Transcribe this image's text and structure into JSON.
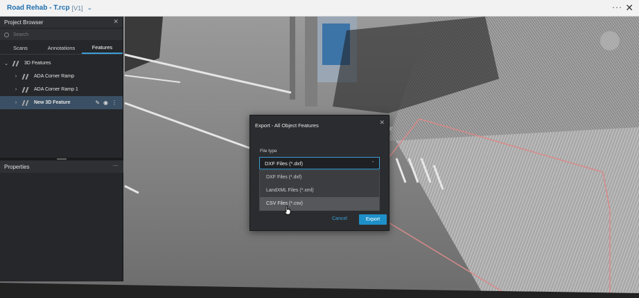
{
  "app": {
    "title": "Road Rehab - T.rcp",
    "version": "[V1]",
    "more_icon": "ellipsis-icon",
    "close_icon": "close-icon"
  },
  "project_browser": {
    "title": "Project Browser",
    "search_placeholder": "Search",
    "tabs": [
      {
        "label": "Scans",
        "active": false
      },
      {
        "label": "Annotations",
        "active": false
      },
      {
        "label": "Features",
        "active": true
      }
    ],
    "tree": {
      "root_label": "3D Features",
      "items": [
        {
          "label": "ADA Corner Ramp",
          "selected": false
        },
        {
          "label": "ADA Corner Ramp 1",
          "selected": false
        },
        {
          "label": "New 3D Feature",
          "selected": true
        }
      ]
    }
  },
  "properties": {
    "title": "Properties"
  },
  "export_dialog": {
    "title": "Export - All Object Features",
    "file_type_label": "File type",
    "selected_value": "DXF Files (*.dxf)",
    "options": [
      {
        "label": "DXF Files (*.dxf)",
        "hover": false
      },
      {
        "label": "LandXML Files (*.xml)",
        "hover": false
      },
      {
        "label": "CSV Files (*.csv)",
        "hover": true
      }
    ],
    "cancel_label": "Cancel",
    "export_label": "Export"
  },
  "colors": {
    "accent": "#1e90c9",
    "panel_bg": "#26272a",
    "selection_bg": "#3a4f63",
    "feature_outline": "#d98a8a"
  }
}
